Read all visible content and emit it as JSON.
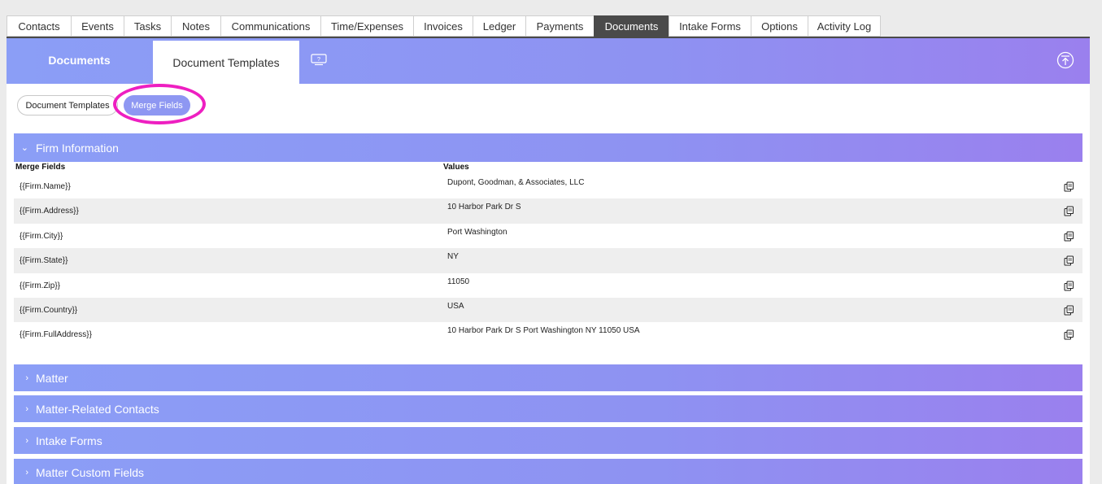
{
  "top_tabs": [
    {
      "label": "Contacts",
      "w": 79
    },
    {
      "label": "Events",
      "w": 65
    },
    {
      "label": "Tasks",
      "w": 58
    },
    {
      "label": "Notes",
      "w": 61
    },
    {
      "label": "Communications",
      "w": 123
    },
    {
      "label": "Time/Expenses",
      "w": 114
    },
    {
      "label": "Invoices",
      "w": 73
    },
    {
      "label": "Ledger",
      "w": 65
    },
    {
      "label": "Payments",
      "w": 84
    },
    {
      "label": "Documents",
      "w": 92,
      "active": true
    },
    {
      "label": "Intake Forms",
      "w": 101
    },
    {
      "label": "Options",
      "w": 70
    },
    {
      "label": "Activity Log",
      "w": 90
    }
  ],
  "banner": {
    "documents_label": "Documents",
    "templates_label": "Document Templates"
  },
  "pills": {
    "templates": "Document Templates",
    "merge_fields": "Merge Fields"
  },
  "sections": {
    "firm": "Firm Information",
    "matter": "Matter",
    "related": "Matter-Related Contacts",
    "intake": "Intake Forms",
    "custom": "Matter Custom Fields"
  },
  "table": {
    "col_fields": "Merge Fields",
    "col_values": "Values",
    "rows": [
      {
        "field": "{{Firm.Name}}",
        "value": "Dupont, Goodman, & Associates, LLC"
      },
      {
        "field": "{{Firm.Address}}",
        "value": "10 Harbor Park Dr S"
      },
      {
        "field": "{{Firm.City}}",
        "value": "Port Washington"
      },
      {
        "field": "{{Firm.State}}",
        "value": "NY"
      },
      {
        "field": "{{Firm.Zip}}",
        "value": "11050"
      },
      {
        "field": "{{Firm.Country}}",
        "value": "USA"
      },
      {
        "field": "{{Firm.FullAddress}}",
        "value": "10 Harbor Park Dr S Port Washington NY 11050 USA"
      }
    ]
  },
  "colors": {
    "accent": "#8e97f2",
    "highlight": "#ee1fc1",
    "active_tab": "#4a4a4a"
  }
}
